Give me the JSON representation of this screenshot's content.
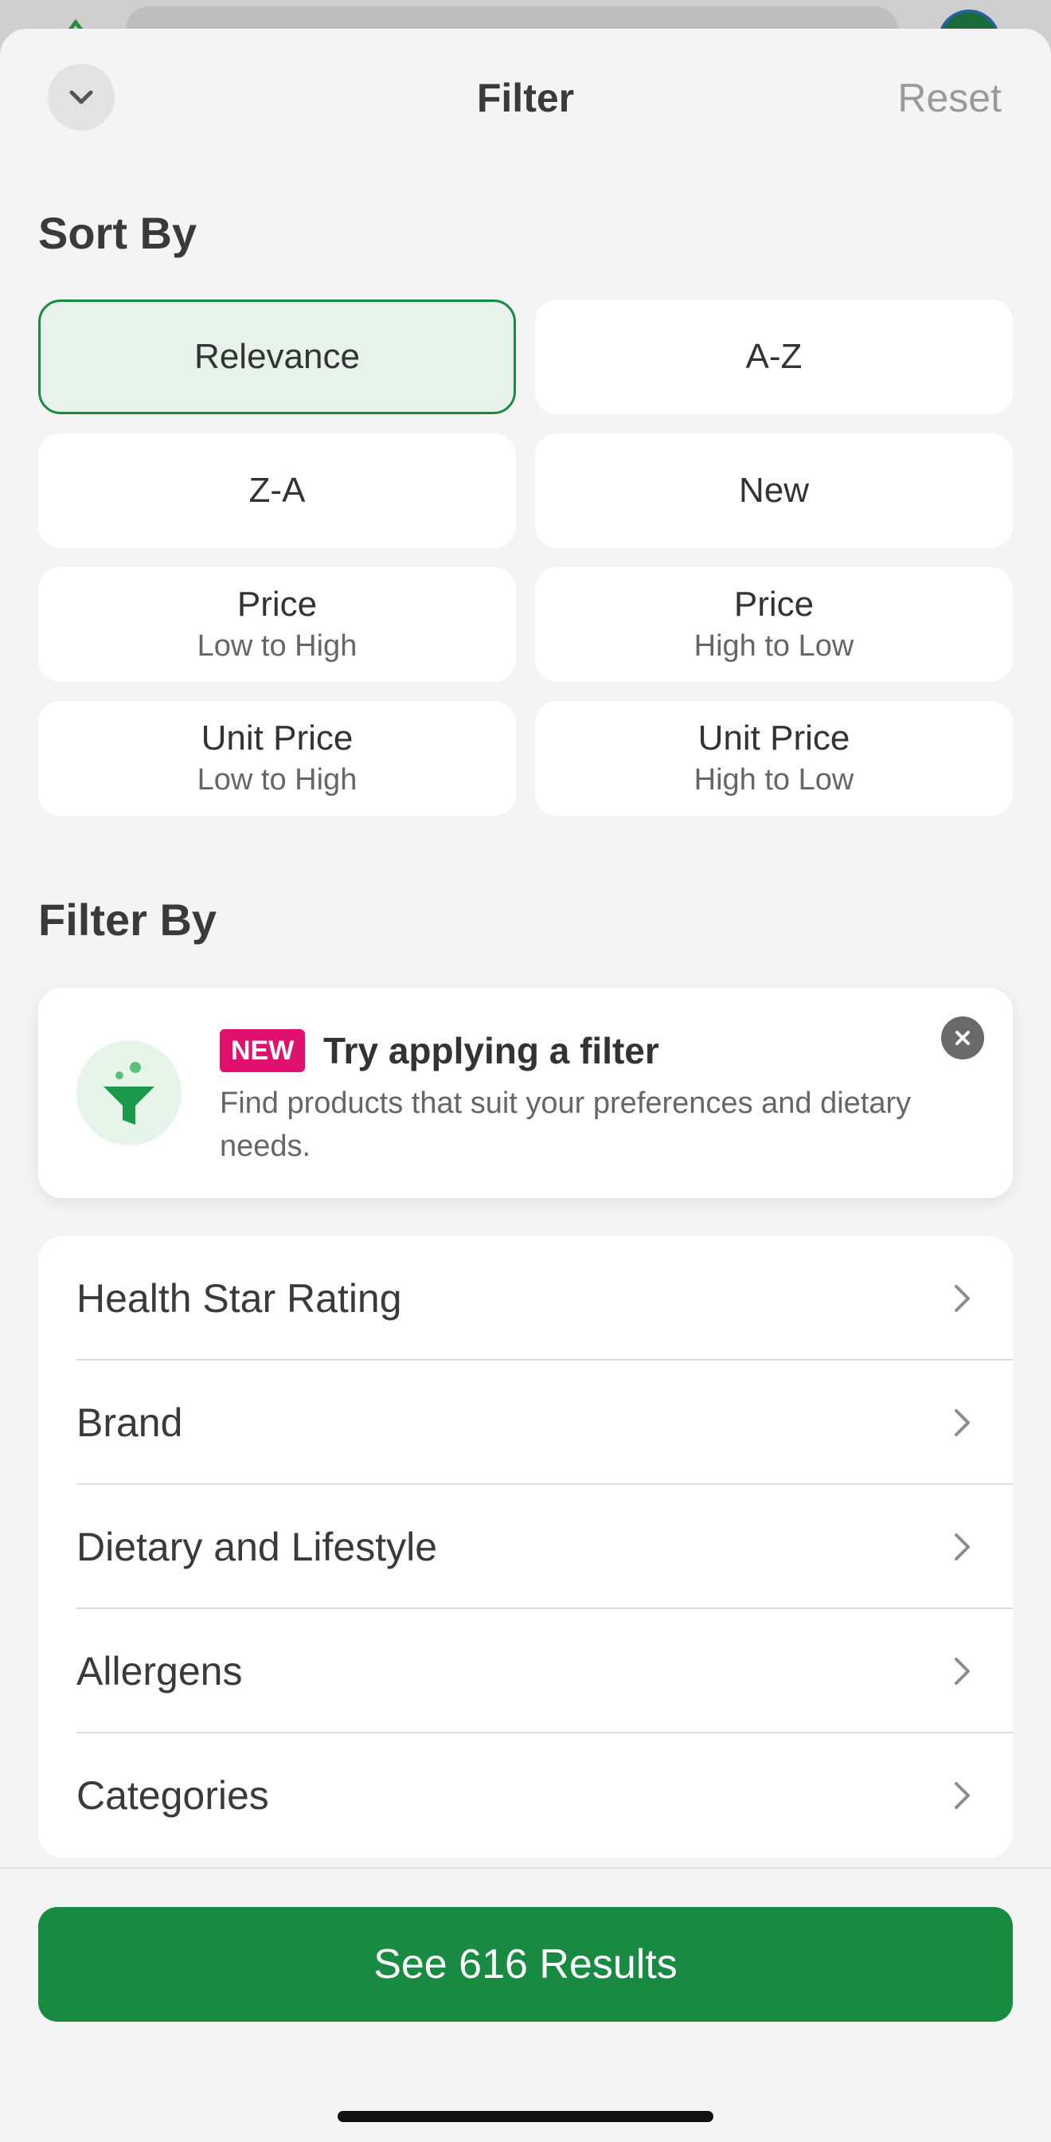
{
  "header": {
    "title": "Filter",
    "reset_label": "Reset"
  },
  "sort": {
    "title": "Sort By",
    "options": [
      {
        "main": "Relevance",
        "sub": "",
        "selected": true
      },
      {
        "main": "A-Z",
        "sub": "",
        "selected": false
      },
      {
        "main": "Z-A",
        "sub": "",
        "selected": false
      },
      {
        "main": "New",
        "sub": "",
        "selected": false
      },
      {
        "main": "Price",
        "sub": "Low to High",
        "selected": false
      },
      {
        "main": "Price",
        "sub": "High to Low",
        "selected": false
      },
      {
        "main": "Unit Price",
        "sub": "Low to High",
        "selected": false
      },
      {
        "main": "Unit Price",
        "sub": "High to Low",
        "selected": false
      }
    ]
  },
  "filter": {
    "title": "Filter By",
    "promo": {
      "badge": "NEW",
      "title": "Try applying a filter",
      "description": "Find products that suit your preferences and dietary needs."
    },
    "items": [
      {
        "label": "Health Star Rating"
      },
      {
        "label": "Brand"
      },
      {
        "label": "Dietary and Lifestyle"
      },
      {
        "label": "Allergens"
      },
      {
        "label": "Categories"
      }
    ]
  },
  "footer": {
    "results_label": "See 616 Results"
  },
  "colors": {
    "accent_green": "#198a42",
    "selected_bg": "#e6f2ea",
    "badge_pink": "#e0106e"
  },
  "icons": [
    "chevron-down-icon",
    "filter-funnel-icon",
    "close-icon",
    "chevron-right-icon"
  ]
}
